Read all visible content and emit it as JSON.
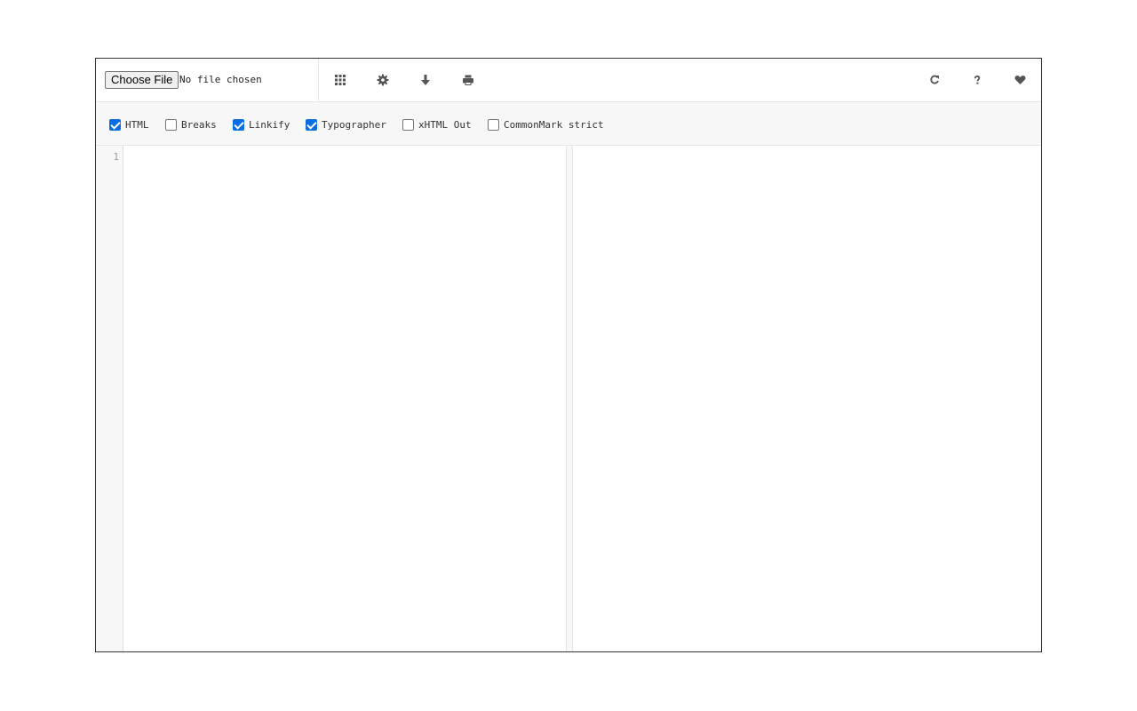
{
  "toolbar": {
    "choose_file_label": "Choose File",
    "file_status": "No file chosen",
    "left_icons": [
      "grid-icon",
      "gear-icon",
      "download-icon",
      "print-icon"
    ],
    "right_icons": [
      "refresh-icon",
      "help-icon",
      "heart-icon"
    ],
    "icon_color": "#555555"
  },
  "options": [
    {
      "label": "HTML",
      "checked": true
    },
    {
      "label": "Breaks",
      "checked": false
    },
    {
      "label": "Linkify",
      "checked": true
    },
    {
      "label": "Typographer",
      "checked": true
    },
    {
      "label": "xHTML Out",
      "checked": false
    },
    {
      "label": "CommonMark strict",
      "checked": false
    }
  ],
  "editor": {
    "line_numbers": [
      "1"
    ],
    "content": ""
  },
  "colors": {
    "accent": "#0b6ee0",
    "option_bar": "#f7f7f7",
    "frame_border": "#333333"
  }
}
